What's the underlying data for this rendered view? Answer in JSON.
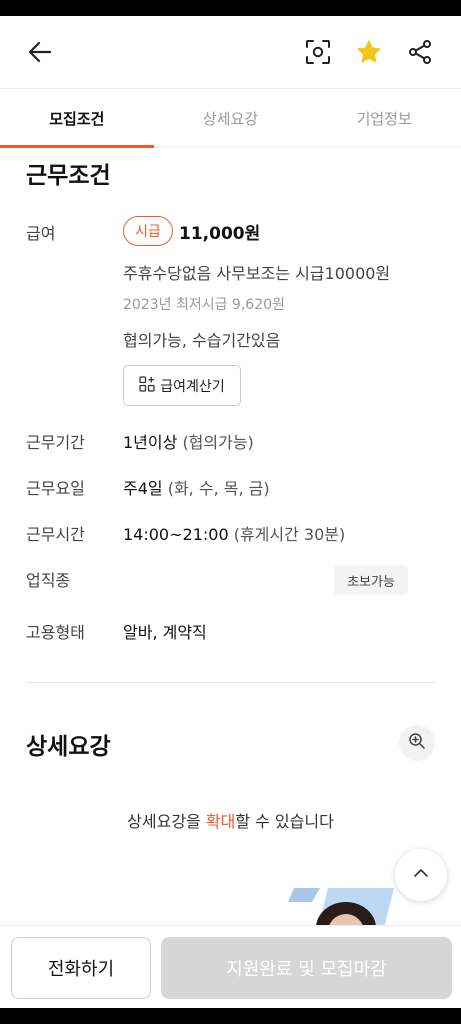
{
  "tabs": [
    {
      "label": "모집조건",
      "active": true
    },
    {
      "label": "상세요강",
      "active": false
    },
    {
      "label": "기업정보",
      "active": false
    }
  ],
  "header": {
    "back_icon": "arrow-left-icon",
    "scan_icon": "scan-icon",
    "star_icon": "star-icon",
    "share_icon": "share-icon",
    "star_color": "#f5c518"
  },
  "conditions": {
    "title": "근무조건",
    "pay": {
      "label": "급여",
      "badge": "시급",
      "amount": "11,000원",
      "note": "주휴수당없음 사무보조는 시급10000원",
      "min_wage": "2023년 최저시급 9,620원",
      "extra": "협의가능, 수습기간있음",
      "calc_button": "급여계산기"
    },
    "period": {
      "label": "근무기간",
      "value": "1년이상",
      "sub": "(협의가능)"
    },
    "days": {
      "label": "근무요일",
      "value": "주4일",
      "sub": "(화, 수, 목, 금)"
    },
    "hours": {
      "label": "근무시간",
      "value": "14:00~21:00",
      "sub": "(휴게시간 30분)"
    },
    "industry": {
      "label": "업직종",
      "tag": "초보가능"
    },
    "employment": {
      "label": "고용형태",
      "value": "알바, 계약직"
    }
  },
  "details": {
    "title": "상세요강",
    "zoom_note_before": "상세요강을 ",
    "zoom_note_accent": "확대",
    "zoom_note_after": "할 수 있습니다"
  },
  "bottom": {
    "call_label": "전화하기",
    "apply_label": "지원완료 및 모집마감"
  },
  "colors": {
    "accent": "#f05a28",
    "disabled": "#d6d6d6"
  }
}
